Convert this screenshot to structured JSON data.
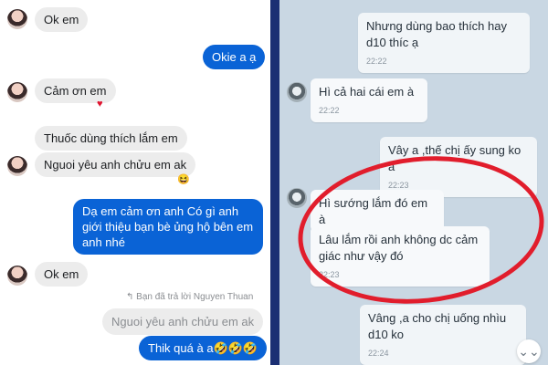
{
  "left_chat": {
    "messages": [
      {
        "text": "Ok em"
      },
      {
        "text": "Okie a ạ"
      },
      {
        "text": "Cảm ơn em"
      },
      {
        "text": "Thuốc dùng thích lắm em"
      },
      {
        "text": "Nguoi yêu anh chửu em ak"
      },
      {
        "text": "Dạ em cảm ơn anh Có gì anh giới thiệu bạn bè ủng hộ bên em anh nhé"
      },
      {
        "text": "Ok em"
      }
    ],
    "reaction_heart": "♥",
    "reaction_laugh": "😆",
    "reply_note": "↰ Bạn đã trả lời Nguyen Thuan",
    "quoted_text": "Nguoi yêu anh chửu em ak",
    "last_reply": "Thik quá à a🤣🤣🤣"
  },
  "right_chat": {
    "messages": [
      {
        "text": "Nhưng dùng bao thích hay d10 thíc ạ",
        "time": "22:22"
      },
      {
        "text": "Hì cả hai cái em à",
        "time": "22:22"
      },
      {
        "text": "Vây a ,thế chị ấy sung ko a",
        "time": "22:23"
      },
      {
        "text": "Hì sướng lắm đó em à",
        "time": ""
      },
      {
        "text": "Lâu lắm rồi anh không dc cảm giác như vậy đó",
        "time": "22:23"
      },
      {
        "text": "Vâng ,a cho chị uống nhìu d10 ko",
        "time": "22:24"
      }
    ],
    "scroll_icon": "⌄⌄"
  },
  "colors": {
    "messenger_blue": "#0a63d6",
    "incoming_gray": "#ececec",
    "divider_navy": "#1b2f73",
    "sms_background": "#c9d7e3",
    "highlight_red": "#e11d2c"
  }
}
